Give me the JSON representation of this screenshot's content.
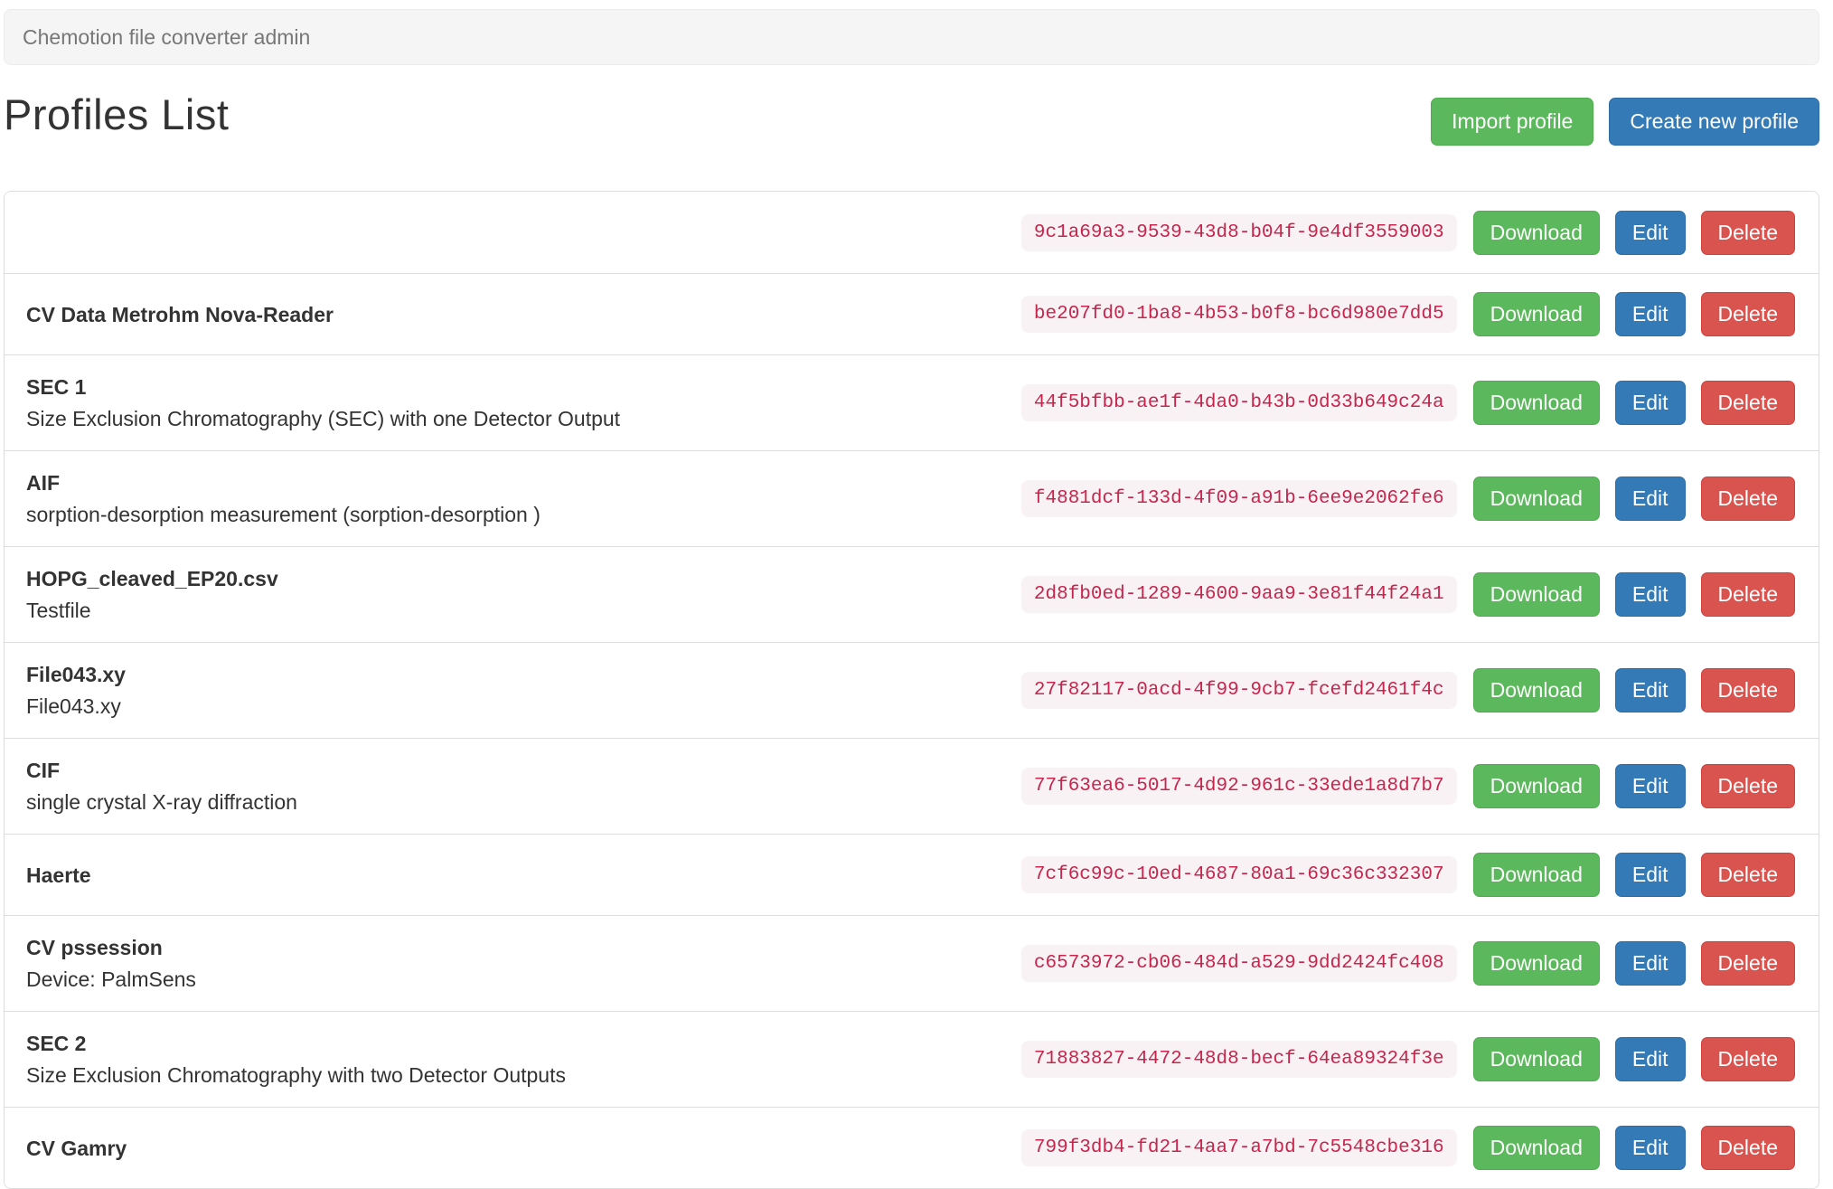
{
  "navbar": {
    "brand": "Chemotion file converter admin"
  },
  "header": {
    "title": "Profiles List",
    "import_button": "Import profile",
    "create_button": "Create new profile"
  },
  "table": {
    "row_buttons": {
      "download": "Download",
      "edit": "Edit",
      "delete": "Delete"
    },
    "rows": [
      {
        "title": "",
        "subtitle": "",
        "uuid": "9c1a69a3-9539-43d8-b04f-9e4df3559003"
      },
      {
        "title": "CV Data Metrohm Nova-Reader",
        "subtitle": "",
        "uuid": "be207fd0-1ba8-4b53-b0f8-bc6d980e7dd5"
      },
      {
        "title": "SEC 1",
        "subtitle": "Size Exclusion Chromatography (SEC) with one Detector Output",
        "uuid": "44f5bfbb-ae1f-4da0-b43b-0d33b649c24a"
      },
      {
        "title": "AIF",
        "subtitle": "sorption-desorption measurement (sorption-desorption )",
        "uuid": "f4881dcf-133d-4f09-a91b-6ee9e2062fe6"
      },
      {
        "title": "HOPG_cleaved_EP20.csv",
        "subtitle": "Testfile",
        "uuid": "2d8fb0ed-1289-4600-9aa9-3e81f44f24a1"
      },
      {
        "title": "File043.xy",
        "subtitle": "File043.xy",
        "uuid": "27f82117-0acd-4f99-9cb7-fcefd2461f4c"
      },
      {
        "title": "CIF",
        "subtitle": "single crystal X-ray diffraction",
        "uuid": "77f63ea6-5017-4d92-961c-33ede1a8d7b7"
      },
      {
        "title": "Haerte",
        "subtitle": "",
        "uuid": "7cf6c99c-10ed-4687-80a1-69c36c332307"
      },
      {
        "title": "CV pssession",
        "subtitle": "Device: PalmSens",
        "uuid": "c6573972-cb06-484d-a529-9dd2424fc408"
      },
      {
        "title": "SEC 2",
        "subtitle": "Size Exclusion Chromatography with two Detector Outputs",
        "uuid": "71883827-4472-48d8-becf-64ea89324f3e"
      },
      {
        "title": "CV Gamry",
        "subtitle": "",
        "uuid": "799f3db4-fd21-4aa7-a7bd-7c5548cbe316"
      }
    ]
  },
  "colors": {
    "success_green": "#5cb85c",
    "primary_blue": "#337ab7",
    "danger_red": "#d9534f",
    "uuid_text": "#c7254e",
    "uuid_background": "#f9f2f4",
    "navbar_background": "#f5f5f5"
  }
}
